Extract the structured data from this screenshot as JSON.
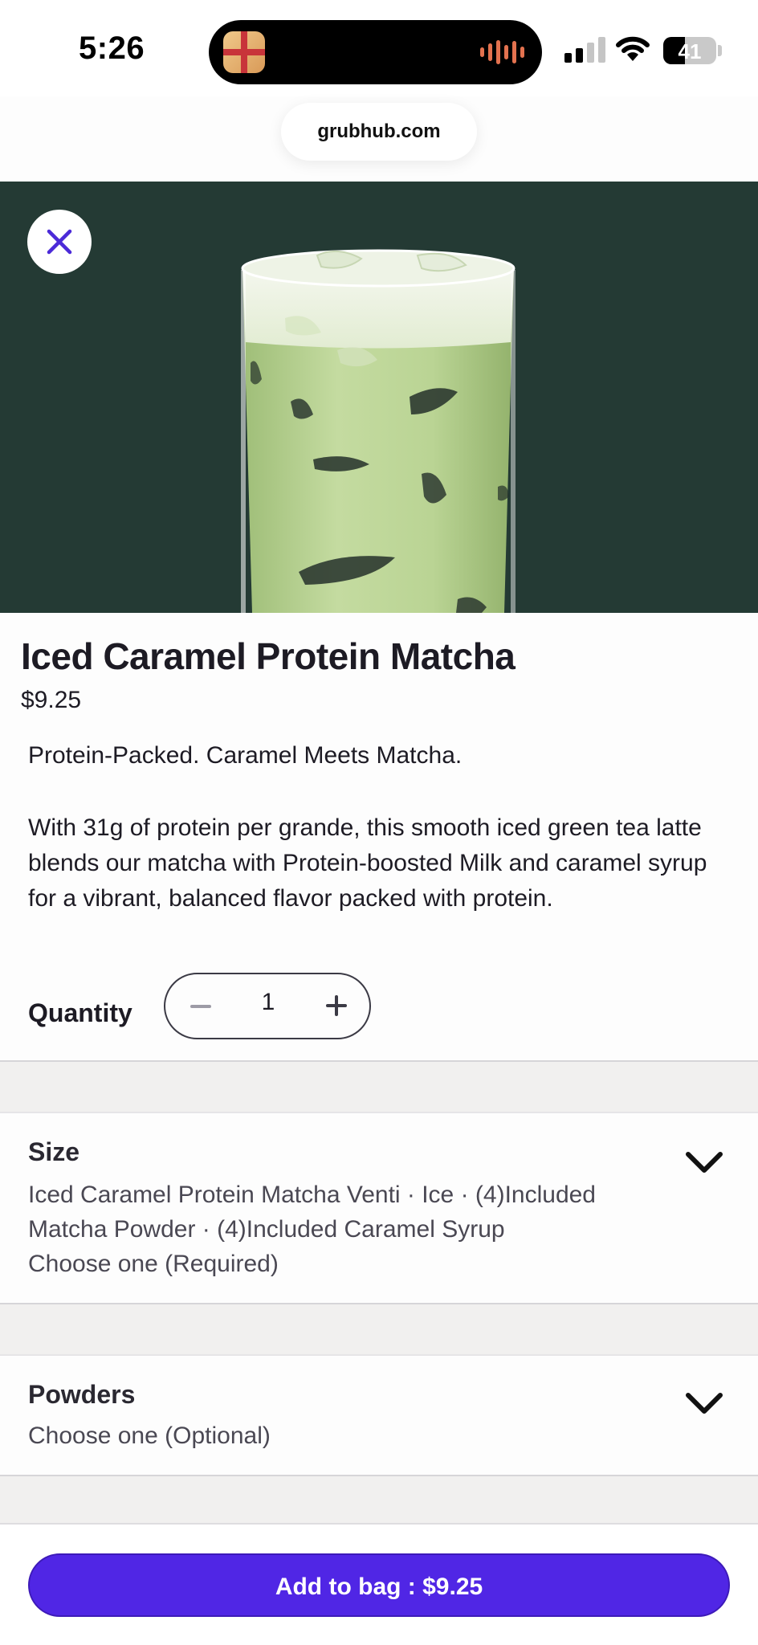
{
  "status_bar": {
    "time": "5:26",
    "battery": "41",
    "battery_level": 0.41,
    "signal_icon": "cellular-signal-icon",
    "wifi_icon": "wifi-icon"
  },
  "browser": {
    "url": "grubhub.com"
  },
  "item": {
    "title": "Iced Caramel Protein Matcha",
    "price": "$9.25",
    "tagline": "Protein-Packed. Caramel Meets Matcha.",
    "description": "With 31g of protein per grande, this smooth iced green tea latte blends our matcha with Protein-boosted Milk and caramel syrup for a vibrant, balanced flavor packed with protein."
  },
  "quantity": {
    "label": "Quantity",
    "value": "1"
  },
  "sections": {
    "size": {
      "title": "Size",
      "selection": "Iced Caramel Protein Matcha Venti · Ice · (4)Included Matcha Powder · (4)Included Caramel Syrup",
      "requirement": "Choose one (Required)"
    },
    "powders": {
      "title": "Powders",
      "requirement": "Choose one (Optional)"
    }
  },
  "footer": {
    "add_button": "Add to bag : $9.25"
  },
  "colors": {
    "accent": "#5026e5",
    "hero_bg": "#243a34",
    "matcha": "#bcd79a"
  }
}
